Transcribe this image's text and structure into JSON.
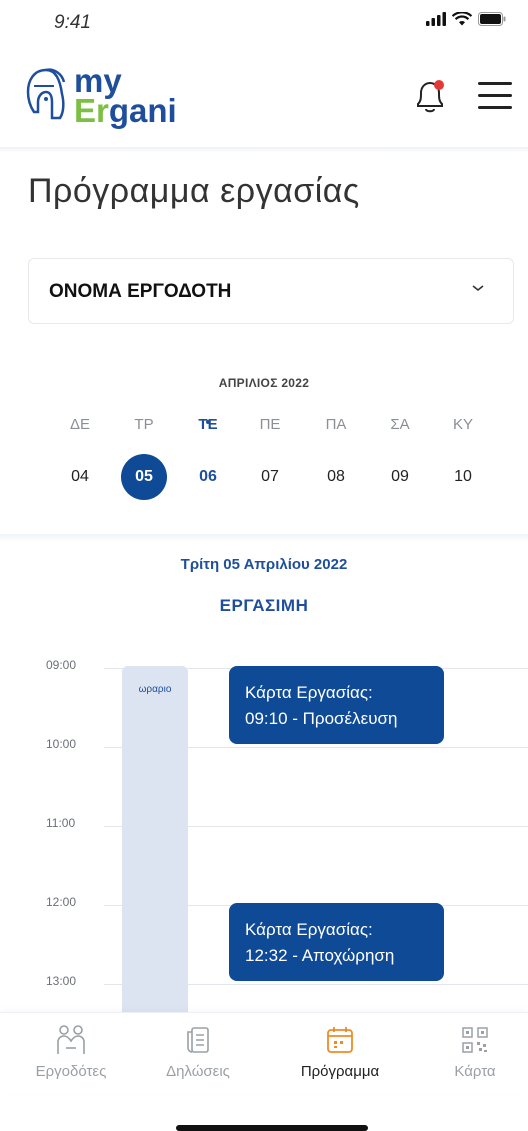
{
  "status_bar": {
    "time": "9:41"
  },
  "header": {
    "logo_my": "my",
    "logo_er": "Er",
    "logo_gani": "gani"
  },
  "page_title": "Πρόγραμμα εργασίας",
  "employer_select": {
    "value": "ΟΝΟΜΑ ΕΡΓΟΔΟΤΗ"
  },
  "calendar": {
    "month": "ΑΠΡΙΛΙΟΣ 2022",
    "days": [
      {
        "name": "ΔΕ",
        "date": "04"
      },
      {
        "name": "ΤΡ",
        "date": "05"
      },
      {
        "name": "ΤΕ",
        "date": "06"
      },
      {
        "name": "ΠΕ",
        "date": "07"
      },
      {
        "name": "ΠΑ",
        "date": "08"
      },
      {
        "name": "ΣΑ",
        "date": "09"
      },
      {
        "name": "ΚΥ",
        "date": "10"
      }
    ],
    "selected_index": 1,
    "today_index": 2
  },
  "selected_day": {
    "full_date": "Τρίτη 05 Απριλίου 2022",
    "type": "ΕΡΓΑΣΙΜΗ"
  },
  "timeline": {
    "hours": [
      "09:00",
      "10:00",
      "11:00",
      "12:00",
      "13:00"
    ],
    "schedule_label": "ωραριο",
    "events": [
      {
        "line1": "Κάρτα Εργασίας:",
        "line2": "09:10 - Προσέλευση"
      },
      {
        "line1": "Κάρτα Εργασίας:",
        "line2": "12:32 - Αποχώρηση"
      }
    ]
  },
  "tabbar": {
    "tabs": [
      {
        "label": "Εργοδότες",
        "icon": "employers-icon"
      },
      {
        "label": "Δηλώσεις",
        "icon": "declarations-icon"
      },
      {
        "label": "Πρόγραμμα",
        "icon": "calendar-icon"
      },
      {
        "label": "Κάρτα",
        "icon": "qr-card-icon"
      }
    ],
    "active_index": 2
  },
  "colors": {
    "primary": "#0f4a96",
    "accent_green": "#7cbf44",
    "notification": "#e53935",
    "active_tab_icon": "#f08a24"
  }
}
